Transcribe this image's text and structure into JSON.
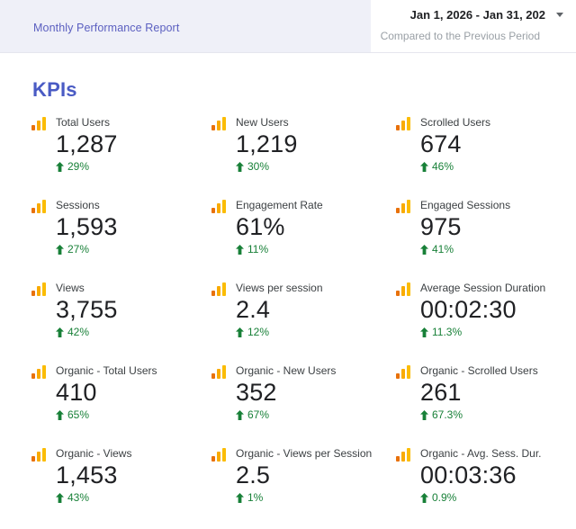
{
  "header": {
    "title": "Monthly Performance Report",
    "date_range": "Jan 1, 2026 - Jan 31, 202",
    "comparison": "Compared to the Previous Period"
  },
  "section_title": "KPIs",
  "icons": {
    "kpi_icon": "bar-chart-icon (three ascending orange bars)",
    "delta_icon": "arrow-up-icon",
    "date_icon": "chevron-down-icon"
  },
  "colors": {
    "header_bg": "#EFF0F8",
    "header_title_text": "#5B5FC0",
    "section_title_text": "#4A5BC4",
    "positive_delta": "#188038",
    "value_text": "#202124",
    "label_text": "#3C4043",
    "muted_text": "#9AA0A6",
    "bar_icon_colors": [
      "#E8710A",
      "#F9AB00",
      "#FBBC04"
    ]
  },
  "kpis": [
    {
      "label": "Total Users",
      "value": "1,287",
      "delta": "29%"
    },
    {
      "label": "New Users",
      "value": "1,219",
      "delta": "30%"
    },
    {
      "label": "Scrolled Users",
      "value": "674",
      "delta": "46%"
    },
    {
      "label": "Sessions",
      "value": "1,593",
      "delta": "27%"
    },
    {
      "label": "Engagement Rate",
      "value": "61%",
      "delta": "11%"
    },
    {
      "label": "Engaged Sessions",
      "value": "975",
      "delta": "41%"
    },
    {
      "label": "Views",
      "value": "3,755",
      "delta": "42%"
    },
    {
      "label": "Views per session",
      "value": "2.4",
      "delta": "12%"
    },
    {
      "label": "Average Session Duration",
      "value": "00:02:30",
      "delta": "11.3%"
    },
    {
      "label": "Organic - Total Users",
      "value": "410",
      "delta": "65%"
    },
    {
      "label": "Organic - New Users",
      "value": "352",
      "delta": "67%"
    },
    {
      "label": "Organic - Scrolled Users",
      "value": "261",
      "delta": "67.3%"
    },
    {
      "label": "Organic - Views",
      "value": "1,453",
      "delta": "43%"
    },
    {
      "label": "Organic - Views per Session",
      "value": "2.5",
      "delta": "1%"
    },
    {
      "label": "Organic - Avg. Sess. Dur.",
      "value": "00:03:36",
      "delta": "0.9%"
    }
  ]
}
